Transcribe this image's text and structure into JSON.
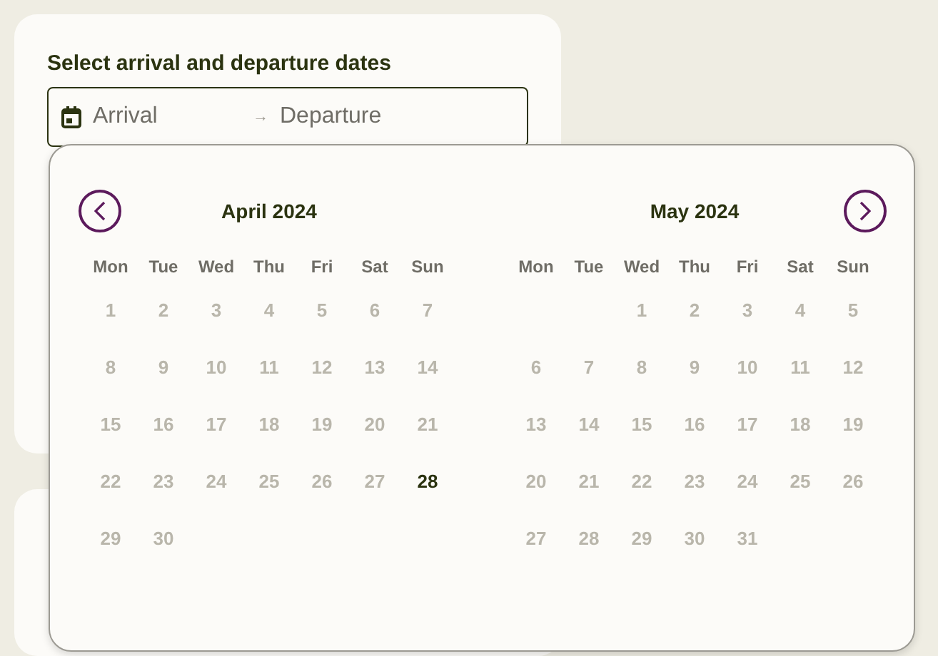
{
  "heading": "Select arrival and departure dates",
  "date_field": {
    "arrival_placeholder": "Arrival",
    "separator": "→",
    "departure_placeholder": "Departure"
  },
  "calendar": {
    "prev_button": {
      "disabled": false
    },
    "next_button": {
      "disabled": false
    },
    "months": [
      {
        "title": "April 2024",
        "weekdays": [
          "Mon",
          "Tue",
          "Wed",
          "Thu",
          "Fri",
          "Sat",
          "Sun"
        ],
        "weeks": [
          [
            {
              "kind": "day",
              "day": "1",
              "disabled": true
            },
            {
              "kind": "day",
              "day": "2",
              "disabled": true
            },
            {
              "kind": "day",
              "day": "3",
              "disabled": true
            },
            {
              "kind": "day",
              "day": "4",
              "disabled": true
            },
            {
              "kind": "day",
              "day": "5",
              "disabled": true
            },
            {
              "kind": "day",
              "day": "6",
              "disabled": true
            },
            {
              "kind": "day",
              "day": "7",
              "disabled": true
            }
          ],
          [
            {
              "kind": "day",
              "day": "8",
              "disabled": true
            },
            {
              "kind": "day",
              "day": "9",
              "disabled": true
            },
            {
              "kind": "day",
              "day": "10",
              "disabled": true
            },
            {
              "kind": "day",
              "day": "11",
              "disabled": true
            },
            {
              "kind": "day",
              "day": "12",
              "disabled": true
            },
            {
              "kind": "day",
              "day": "13",
              "disabled": true
            },
            {
              "kind": "day",
              "day": "14",
              "disabled": true
            }
          ],
          [
            {
              "kind": "day",
              "day": "15",
              "disabled": true
            },
            {
              "kind": "day",
              "day": "16",
              "disabled": true
            },
            {
              "kind": "day",
              "day": "17",
              "disabled": true
            },
            {
              "kind": "day",
              "day": "18",
              "disabled": true
            },
            {
              "kind": "day",
              "day": "19",
              "disabled": true
            },
            {
              "kind": "day",
              "day": "20",
              "disabled": true
            },
            {
              "kind": "day",
              "day": "21",
              "disabled": true
            }
          ],
          [
            {
              "kind": "day",
              "day": "22",
              "disabled": true
            },
            {
              "kind": "day",
              "day": "23",
              "disabled": true
            },
            {
              "kind": "day",
              "day": "24",
              "disabled": true
            },
            {
              "kind": "day",
              "day": "25",
              "disabled": true
            },
            {
              "kind": "day",
              "day": "26",
              "disabled": true
            },
            {
              "kind": "day",
              "day": "27",
              "disabled": true
            },
            {
              "kind": "day",
              "day": "28",
              "disabled": false
            }
          ],
          [
            {
              "kind": "day",
              "day": "29",
              "disabled": true
            },
            {
              "kind": "day",
              "day": "30",
              "disabled": true
            },
            {
              "kind": "blank"
            },
            {
              "kind": "blank"
            },
            {
              "kind": "blank"
            },
            {
              "kind": "blank"
            },
            {
              "kind": "blank"
            }
          ]
        ]
      },
      {
        "title": "May 2024",
        "weekdays": [
          "Mon",
          "Tue",
          "Wed",
          "Thu",
          "Fri",
          "Sat",
          "Sun"
        ],
        "weeks": [
          [
            {
              "kind": "blank"
            },
            {
              "kind": "blank"
            },
            {
              "kind": "day",
              "day": "1",
              "disabled": true
            },
            {
              "kind": "day",
              "day": "2",
              "disabled": true
            },
            {
              "kind": "day",
              "day": "3",
              "disabled": true
            },
            {
              "kind": "day",
              "day": "4",
              "disabled": true
            },
            {
              "kind": "day",
              "day": "5",
              "disabled": true
            }
          ],
          [
            {
              "kind": "day",
              "day": "6",
              "disabled": true
            },
            {
              "kind": "day",
              "day": "7",
              "disabled": true
            },
            {
              "kind": "day",
              "day": "8",
              "disabled": true
            },
            {
              "kind": "day",
              "day": "9",
              "disabled": true
            },
            {
              "kind": "day",
              "day": "10",
              "disabled": true
            },
            {
              "kind": "day",
              "day": "11",
              "disabled": true
            },
            {
              "kind": "day",
              "day": "12",
              "disabled": true
            }
          ],
          [
            {
              "kind": "day",
              "day": "13",
              "disabled": true
            },
            {
              "kind": "day",
              "day": "14",
              "disabled": true
            },
            {
              "kind": "day",
              "day": "15",
              "disabled": true
            },
            {
              "kind": "day",
              "day": "16",
              "disabled": true
            },
            {
              "kind": "day",
              "day": "17",
              "disabled": true
            },
            {
              "kind": "day",
              "day": "18",
              "disabled": true
            },
            {
              "kind": "day",
              "day": "19",
              "disabled": true
            }
          ],
          [
            {
              "kind": "day",
              "day": "20",
              "disabled": true
            },
            {
              "kind": "day",
              "day": "21",
              "disabled": true
            },
            {
              "kind": "day",
              "day": "22",
              "disabled": true
            },
            {
              "kind": "day",
              "day": "23",
              "disabled": true
            },
            {
              "kind": "day",
              "day": "24",
              "disabled": true
            },
            {
              "kind": "day",
              "day": "25",
              "disabled": true
            },
            {
              "kind": "day",
              "day": "26",
              "disabled": true
            }
          ],
          [
            {
              "kind": "day",
              "day": "27",
              "disabled": true
            },
            {
              "kind": "day",
              "day": "28",
              "disabled": true
            },
            {
              "kind": "day",
              "day": "29",
              "disabled": true
            },
            {
              "kind": "day",
              "day": "30",
              "disabled": true
            },
            {
              "kind": "day",
              "day": "31",
              "disabled": true
            },
            {
              "kind": "blank"
            },
            {
              "kind": "blank"
            }
          ]
        ]
      }
    ]
  }
}
